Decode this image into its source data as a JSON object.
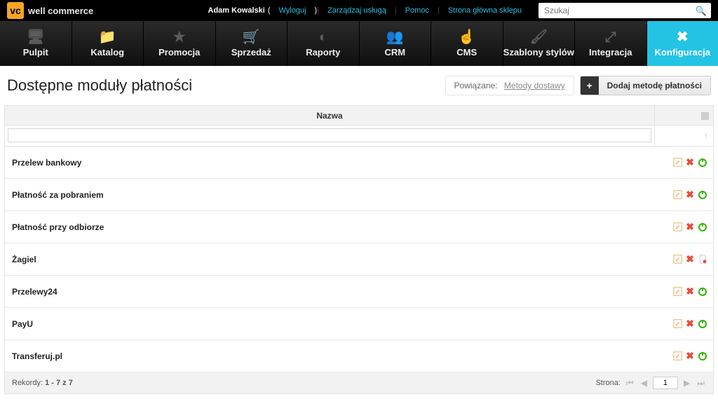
{
  "brand": {
    "name": "well commerce",
    "mark": "vc"
  },
  "header": {
    "user_name": "Adam Kowalski",
    "logout_label": "Wyloguj",
    "links": {
      "manage_service": "Zarządzaj usługą",
      "help": "Pomoc",
      "shop_home": "Strona główna sklepu"
    },
    "search_placeholder": "Szukaj"
  },
  "nav": [
    {
      "label": "Pulpit",
      "icon": "🖥"
    },
    {
      "label": "Katalog",
      "icon": "📁"
    },
    {
      "label": "Promocja",
      "icon": "★"
    },
    {
      "label": "Sprzedaż",
      "icon": "🛒"
    },
    {
      "label": "Raporty",
      "icon": "◐"
    },
    {
      "label": "CRM",
      "icon": "👥"
    },
    {
      "label": "CMS",
      "icon": "☝"
    },
    {
      "label": "Szablony stylów",
      "icon": "🖌"
    },
    {
      "label": "Integracja",
      "icon": "⤢"
    },
    {
      "label": "Konfiguracja",
      "icon": "✖"
    }
  ],
  "page": {
    "title": "Dostępne moduły płatności",
    "related_label": "Powiązane:",
    "related_link": "Metody dostawy",
    "add_button": "Dodaj metodę płatności"
  },
  "grid": {
    "column_name": "Nazwa",
    "rows": [
      {
        "name": "Przelew bankowy",
        "file": false
      },
      {
        "name": "Płatność za pobraniem",
        "file": false
      },
      {
        "name": "Płatność przy odbiorze",
        "file": false
      },
      {
        "name": "Żagiel",
        "file": true
      },
      {
        "name": "Przelewy24",
        "file": false
      },
      {
        "name": "PayU",
        "file": false
      },
      {
        "name": "Transferuj.pl",
        "file": false
      }
    ],
    "footer": {
      "records_label": "Rekordy:",
      "records_value": "1 - 7 z 7",
      "page_label": "Strona:",
      "page_value": "1"
    }
  }
}
